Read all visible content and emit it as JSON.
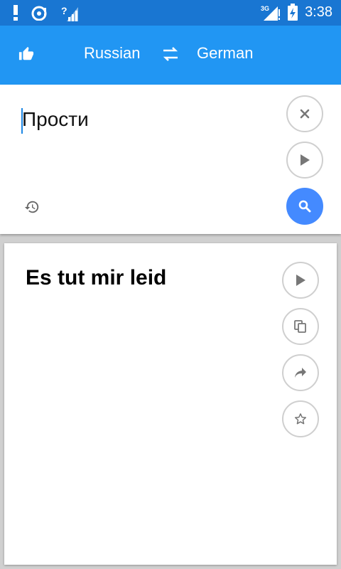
{
  "status_bar": {
    "time": "3:38",
    "network_label": "3G",
    "icons": [
      "alert-icon",
      "sync-icon",
      "wifi-unknown-icon",
      "signal-icon",
      "battery-charging-icon"
    ]
  },
  "header": {
    "source_language": "Russian",
    "target_language": "German",
    "icons": [
      "thumbs-up-icon",
      "swap-icon"
    ]
  },
  "input": {
    "text": "Прости",
    "icons": [
      "clear-icon",
      "play-icon",
      "history-icon",
      "search-icon"
    ]
  },
  "output": {
    "text": "Es tut mir leid",
    "icons": [
      "play-icon",
      "copy-icon",
      "share-icon",
      "star-icon"
    ]
  },
  "colors": {
    "status_bar": "#1976d2",
    "app_bar": "#2196f3",
    "search_button": "#448aff",
    "background": "#d0d0d0"
  }
}
